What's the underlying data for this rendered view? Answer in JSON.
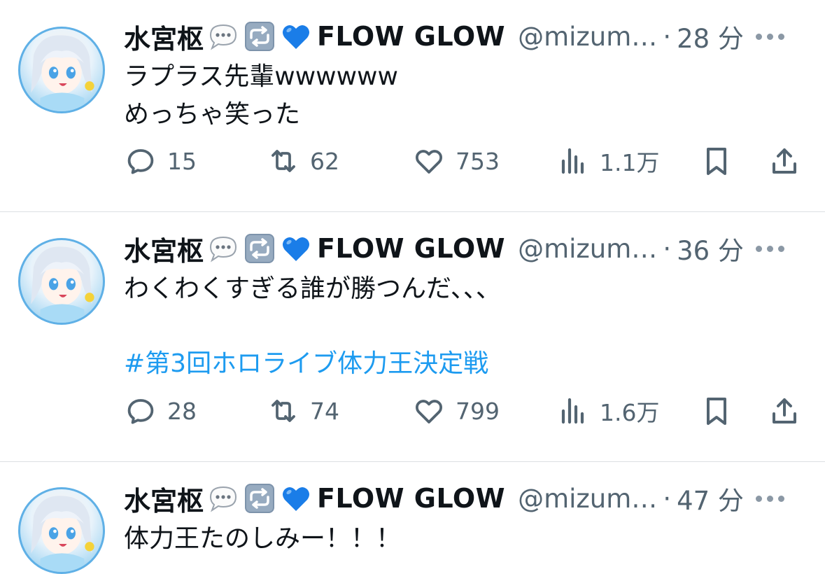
{
  "tweets": [
    {
      "author": "水宮枢",
      "brand": "FLOW GLOW",
      "handle": "@mizum…",
      "separator": "·",
      "time": "28 分",
      "lines": [
        "ラプラス先輩wwwwww",
        "めっちゃ笑った"
      ],
      "hashtag": "",
      "replies": "15",
      "reposts": "62",
      "likes": "753",
      "views": "1.1万"
    },
    {
      "author": "水宮枢",
      "brand": "FLOW GLOW",
      "handle": "@mizum…",
      "separator": "·",
      "time": "36 分",
      "lines": [
        "わくわくすぎる誰が勝つんだ、、、"
      ],
      "hashtag": "#第3回ホロライブ体力王決定戦",
      "replies": "28",
      "reposts": "74",
      "likes": "799",
      "views": "1.6万"
    },
    {
      "author": "水宮枢",
      "brand": "FLOW GLOW",
      "handle": "@mizum…",
      "separator": "·",
      "time": "47 分",
      "lines": [
        "体力王たのしみー！！！"
      ],
      "hashtag": "",
      "replies": "",
      "reposts": "",
      "likes": "",
      "views": ""
    }
  ],
  "icons": {
    "author_emojis": [
      "speech-balloon-icon",
      "repeat-arrows-icon",
      "blue-heart-icon"
    ],
    "action_icons": [
      "reply-icon",
      "repost-icon",
      "like-icon",
      "views-icon",
      "bookmark-icon",
      "share-icon"
    ],
    "more": "more-options-icon"
  },
  "colors": {
    "text": "#0f1419",
    "secondary": "#536471",
    "link": "#1d9bf0",
    "divider": "#dcdfe3",
    "avatar_border": "#5fb0e6"
  }
}
